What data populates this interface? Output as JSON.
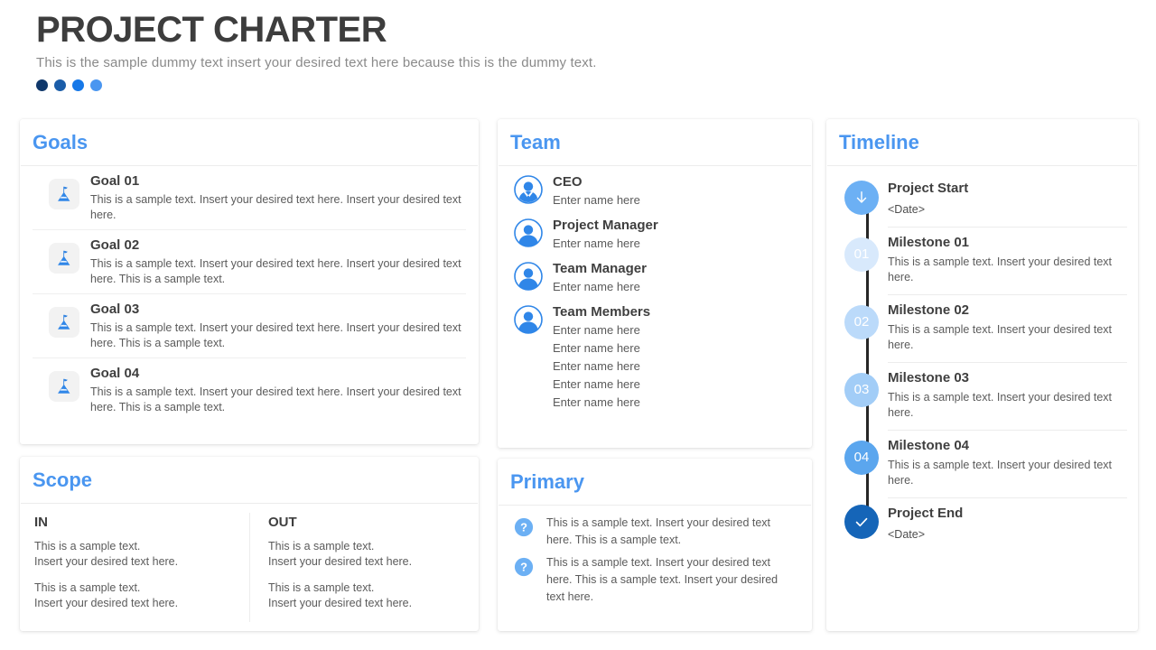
{
  "header": {
    "title": "PROJECT CHARTER",
    "subtitle": "This is the sample dummy text insert your desired text here because this is the dummy text.",
    "dots": [
      "#10386b",
      "#1b5da8",
      "#1678e8",
      "#4a96f0"
    ]
  },
  "goals": {
    "title": "Goals",
    "items": [
      {
        "name": "Goal 01",
        "desc": "This is a sample text. Insert your desired text here. Insert your desired text here."
      },
      {
        "name": "Goal 02",
        "desc": "This is a sample text. Insert your desired text here. Insert your desired text here. This is a sample text."
      },
      {
        "name": "Goal 03",
        "desc": "This is a sample text. Insert your desired text here. Insert your desired text here. This is a sample text."
      },
      {
        "name": "Goal 04",
        "desc": "This is a sample text. Insert your desired text here. Insert your desired text here. This is a sample text."
      }
    ],
    "icon": "mountain-flag-icon"
  },
  "team": {
    "title": "Team",
    "members": [
      {
        "role": "CEO",
        "names": [
          "Enter name here"
        ],
        "icon": "person-suit-icon"
      },
      {
        "role": "Project Manager",
        "names": [
          "Enter name here"
        ],
        "icon": "person-icon"
      },
      {
        "role": "Team Manager",
        "names": [
          "Enter name here"
        ],
        "icon": "person-icon"
      },
      {
        "role": "Team Members",
        "names": [
          "Enter name here",
          "Enter name here",
          "Enter name here",
          "Enter name here",
          "Enter name here"
        ],
        "icon": "person-icon"
      }
    ]
  },
  "timeline": {
    "title": "Timeline",
    "items": [
      {
        "label": "Project Start",
        "date": "<Date>",
        "desc": "",
        "badge": "",
        "icon": "arrow-down-icon",
        "color": "#6cb0f4"
      },
      {
        "label": "Milestone 01",
        "date": "",
        "desc": "This is a sample text. Insert your desired text here.",
        "badge": "01",
        "icon": "",
        "color": "#d8e9fc"
      },
      {
        "label": "Milestone 02",
        "date": "",
        "desc": "This is a sample text. Insert your desired text here.",
        "badge": "02",
        "icon": "",
        "color": "#bbdafa"
      },
      {
        "label": "Milestone 03",
        "date": "",
        "desc": "This is a sample text. Insert your desired text here.",
        "badge": "03",
        "icon": "",
        "color": "#a2cdf7"
      },
      {
        "label": "Milestone 04",
        "date": "",
        "desc": "This is a sample text. Insert your desired text here.",
        "badge": "04",
        "icon": "",
        "color": "#5ba6ee"
      },
      {
        "label": "Project End",
        "date": "<Date>",
        "desc": "",
        "badge": "",
        "icon": "check-icon",
        "color": "#1565b8"
      }
    ]
  },
  "scope": {
    "title": "Scope",
    "in": {
      "heading": "IN",
      "lines": [
        "This is a sample text.\nInsert your desired text here.",
        "This is a sample text.\nInsert your desired text here."
      ]
    },
    "out": {
      "heading": "OUT",
      "lines": [
        "This is a sample text.\nInsert your desired text here.",
        "This is a sample text.\nInsert your desired text here."
      ]
    }
  },
  "primary": {
    "title": "Primary",
    "items": [
      {
        "text": "This is a sample text. Insert your desired text here. This is a sample text.",
        "icon": "question-icon"
      },
      {
        "text": "This is a sample text. Insert your desired text here. This is a sample text. Insert your desired text here.",
        "icon": "question-icon"
      }
    ]
  },
  "theme": {
    "accent": "#4a96f0",
    "heading_text": "#3d3d3d",
    "body_text": "#5b5b5b"
  }
}
